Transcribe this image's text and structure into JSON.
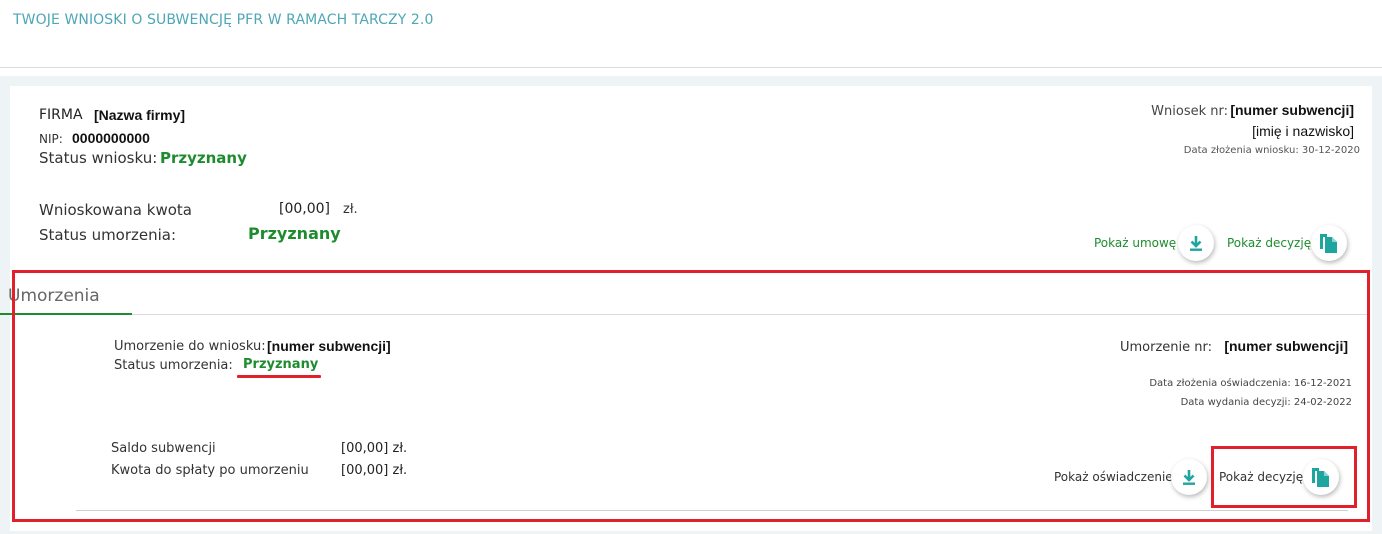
{
  "page": {
    "title": "TWOJE WNIOSKI O SUBWENCJĘ PFR W RAMACH TARCZY 2.0"
  },
  "application": {
    "firma_label": "FIRMA",
    "firma_name": "[Nazwa firmy]",
    "nip_label": "NIP:",
    "nip_value": "0000000000",
    "status_label": "Status wniosku:",
    "status_value": "Przyznany",
    "wniosek_label": "Wniosek nr:",
    "wniosek_value": "[numer subwencji]",
    "person": "[imię i nazwisko]",
    "submitted": "Data złożenia wniosku: 30-12-2020",
    "kwota_label": "Wnioskowana kwota",
    "kwota_value": "[00,00]",
    "currency": "zł.",
    "umorzenie_status_label": "Status umorzenia:",
    "umorzenie_status_value": "Przyznany",
    "actions": {
      "show_contract": "Pokaż umowę",
      "show_decision": "Pokaż decyzję"
    }
  },
  "tab": {
    "label": "Umorzenia"
  },
  "umorzenie": {
    "label": "Umorzenie do wniosku:",
    "value": "[numer subwencji]",
    "status_label": "Status umorzenia:",
    "status_value": "Przyznany",
    "nr_label": "Umorzenie nr:",
    "nr_value": "[numer subwencji]",
    "date_statement": "Data złożenia oświadczenia: 16-12-2021",
    "date_decision": "Data wydania decyzji: 24-02-2022",
    "saldo_label": "Saldo subwencji",
    "saldo_value": "[00,00] zł.",
    "splata_label": "Kwota do spłaty po umorzeniu",
    "splata_value": "[00,00] zł.",
    "actions": {
      "show_statement": "Pokaż oświadczenie",
      "show_decision": "Pokaż decyzję"
    }
  },
  "colors": {
    "accent_teal": "#4da7b6",
    "success_green": "#1e8c2e",
    "highlight_red": "#e0202a",
    "icon_teal": "#1fa5a0"
  },
  "icons": [
    "download-icon",
    "document-copy-icon"
  ]
}
